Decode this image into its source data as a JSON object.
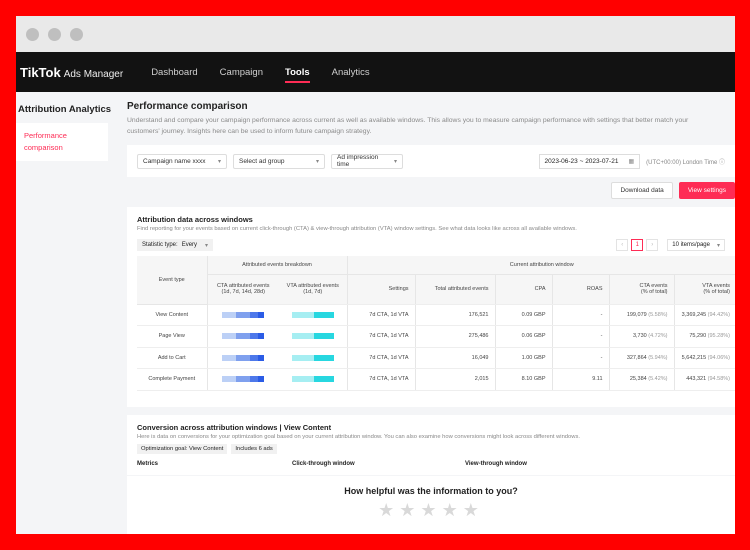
{
  "nav": {
    "brand": "TikTok",
    "brand_sub": "Ads Manager",
    "items": [
      {
        "label": "Dashboard",
        "active": false
      },
      {
        "label": "Campaign",
        "active": false
      },
      {
        "label": "Tools",
        "active": true
      },
      {
        "label": "Analytics",
        "active": false
      }
    ]
  },
  "sidebar": {
    "title": "Attribution Analytics",
    "item": "Performance comparison"
  },
  "page": {
    "title": "Performance comparison",
    "description": "Understand and compare your campaign performance across current as well as available windows. This allows you to measure campaign performance with settings that better match your customers' journey. Insights here can be used to inform future campaign strategy."
  },
  "filters": {
    "campaign": "Campaign name xxxx",
    "ad_group": "Select ad group",
    "impression_time": "Ad impression time",
    "date_range": "2023-06-23 ~ 2023-07-21",
    "timezone": "(UTC+00:00) London Time"
  },
  "buttons": {
    "download": "Download data",
    "view_settings": "View settings"
  },
  "attribution": {
    "title": "Attribution data across windows",
    "description": "Find reporting for your events based on current click-through (CTA) & view-through attribution (VTA) window settings. See what data looks like across all available windows.",
    "stat_label": "Statistic type:",
    "stat_value": "Every",
    "page_number": "1",
    "per_page": "10 items/page",
    "headers": {
      "event_type": "Event type",
      "breakdown": "Attributed events breakdown",
      "current": "Current attribution window",
      "cta_attr": "CTA attributed events",
      "cta_attr_sub": "(1d, 7d, 14d, 28d)",
      "vta_attr": "VTA attributed events",
      "vta_attr_sub": "(1d, 7d)",
      "settings": "Settings",
      "total": "Total attributed events",
      "cpa": "CPA",
      "roas": "ROAS",
      "cta_events": "CTA events",
      "cta_events_sub": "(% of total)",
      "vta_events": "VTA events",
      "vta_events_sub": "(% of total)"
    },
    "rows": [
      {
        "event": "View Content",
        "settings": "7d CTA, 1d VTA",
        "total": "176,521",
        "cpa": "0.09 GBP",
        "roas": "-",
        "cta": "199,079",
        "cta_pct": "(5.58%)",
        "vta": "3,369,245",
        "vta_pct": "(94.42%)"
      },
      {
        "event": "Page View",
        "settings": "7d CTA, 1d VTA",
        "total": "275,486",
        "cpa": "0.06 GBP",
        "roas": "-",
        "cta": "3,730",
        "cta_pct": "(4.72%)",
        "vta": "75,290",
        "vta_pct": "(95.28%)"
      },
      {
        "event": "Add to Cart",
        "settings": "7d CTA, 1d VTA",
        "total": "16,049",
        "cpa": "1.00 GBP",
        "roas": "-",
        "cta": "327,864",
        "cta_pct": "(5.94%)",
        "vta": "5,642,215",
        "vta_pct": "(94.06%)"
      },
      {
        "event": "Complete Payment",
        "settings": "7d CTA, 1d VTA",
        "total": "2,015",
        "cpa": "8.10 GBP",
        "roas": "9.11",
        "cta": "25,384",
        "cta_pct": "(5.42%)",
        "vta": "443,321",
        "vta_pct": "(94.58%)"
      }
    ],
    "colors": {
      "cta": "#2b5ce6",
      "vta": "#27d7e0"
    }
  },
  "conversion": {
    "title": "Conversion across attribution windows | View Content",
    "description": "Here is data on conversions for your optimization goal based on your current attribution window. You can also examine how conversions might look across different windows.",
    "tag_goal": "Optimization goal: View Content",
    "tag_ads": "Includes 6 ads",
    "col_metrics": "Metrics",
    "col_click": "Click-through window",
    "col_view": "View-through window"
  },
  "feedback": {
    "question": "How helpful was the information to you?",
    "stars": "★★★★★"
  }
}
